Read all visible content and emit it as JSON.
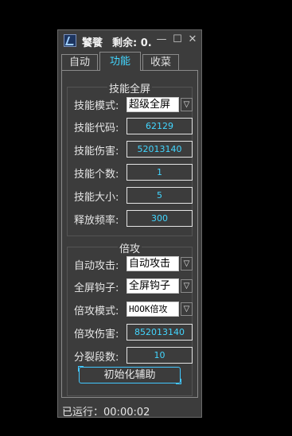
{
  "window": {
    "title": "饕餮",
    "remaining": "剩余: 0...",
    "minimize_label": "—",
    "restore_label": "☐",
    "close_label": "✕"
  },
  "tabs": [
    {
      "label": "自动",
      "active": false
    },
    {
      "label": "功能",
      "active": true
    },
    {
      "label": "收菜",
      "active": false
    }
  ],
  "skill_section": {
    "title": "技能全屏",
    "mode_label": "技能模式:",
    "mode_value": "超级全屏",
    "code_label": "技能代码:",
    "code_value": "62129",
    "damage_label": "技能伤害:",
    "damage_value": "52013140",
    "count_label": "技能个数:",
    "count_value": "1",
    "size_label": "技能大小:",
    "size_value": "5",
    "freq_label": "释放频率:",
    "freq_value": "300"
  },
  "attack_section": {
    "title": "倍攻",
    "auto_label": "自动攻击:",
    "auto_value": "自动攻击",
    "hook_label": "全屏钩子:",
    "hook_value": "全屏钩子",
    "mode_label": "倍攻模式:",
    "mode_value": "HOOK倍攻",
    "damage_label": "倍攻伤害:",
    "damage_value": "852013140",
    "split_label": "分裂段数:",
    "split_value": "10"
  },
  "init_button": "初始化辅助",
  "status": {
    "label": "已运行：",
    "time": "00:00:02"
  },
  "colors": {
    "accent": "#42d6ff",
    "window_bg": "#3c3c3c",
    "background": "#000000"
  },
  "icons": {
    "app": "app-logo-icon",
    "dropdown": "chevron-down-icon"
  }
}
